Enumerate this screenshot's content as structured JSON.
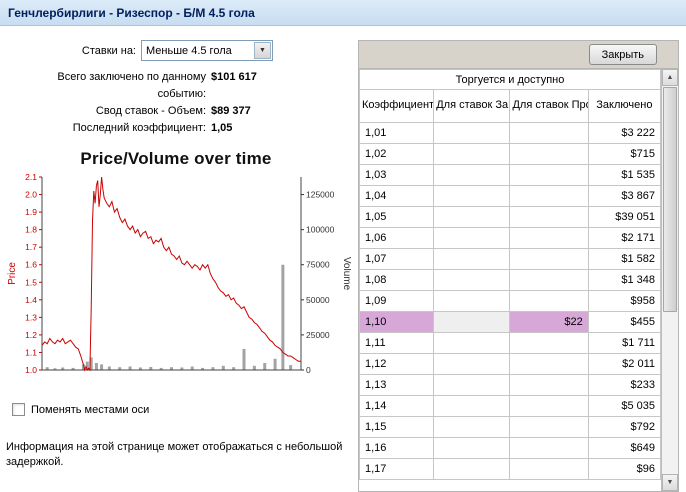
{
  "header": {
    "title": "Генчлербирлиги - Ризеспор - Б/М 4.5 гола"
  },
  "left_panel": {
    "bet_on_label": "Ставки на:",
    "bet_on_value": "Меньше 4.5 гола",
    "stats": [
      {
        "label": "Всего заключено по данному событию:",
        "value": "$101 617"
      },
      {
        "label": "Свод ставок - Объем:",
        "value": "$89 377"
      },
      {
        "label": "Последний коэффициент:",
        "value": "1,05"
      }
    ],
    "swap_axes_label": "Поменять местами оси",
    "disclaimer": "Информация на этой странице может отображаться с небольшой задержкой."
  },
  "table": {
    "close_button_label": "Закрыть",
    "group_header": "Торгуется и доступно",
    "columns": [
      "Коэффициент",
      "Для ставок За",
      "Для ставок Против",
      "Заключено"
    ],
    "highlight_color": "#d7a8d7",
    "rows": [
      {
        "coefficient": "1,01",
        "back": "",
        "lay": "",
        "matched": "$3 222",
        "highlighted": false
      },
      {
        "coefficient": "1,02",
        "back": "",
        "lay": "",
        "matched": "$715",
        "highlighted": false
      },
      {
        "coefficient": "1,03",
        "back": "",
        "lay": "",
        "matched": "$1 535",
        "highlighted": false
      },
      {
        "coefficient": "1,04",
        "back": "",
        "lay": "",
        "matched": "$3 867",
        "highlighted": false
      },
      {
        "coefficient": "1,05",
        "back": "",
        "lay": "",
        "matched": "$39 051",
        "highlighted": false
      },
      {
        "coefficient": "1,06",
        "back": "",
        "lay": "",
        "matched": "$2 171",
        "highlighted": false
      },
      {
        "coefficient": "1,07",
        "back": "",
        "lay": "",
        "matched": "$1 582",
        "highlighted": false
      },
      {
        "coefficient": "1,08",
        "back": "",
        "lay": "",
        "matched": "$1 348",
        "highlighted": false
      },
      {
        "coefficient": "1,09",
        "back": "",
        "lay": "",
        "matched": "$958",
        "highlighted": false
      },
      {
        "coefficient": "1,10",
        "back": "",
        "lay": "$22",
        "matched": "$455",
        "highlighted": true
      },
      {
        "coefficient": "1,11",
        "back": "",
        "lay": "",
        "matched": "$1 711",
        "highlighted": false
      },
      {
        "coefficient": "1,12",
        "back": "",
        "lay": "",
        "matched": "$2 011",
        "highlighted": false
      },
      {
        "coefficient": "1,13",
        "back": "",
        "lay": "",
        "matched": "$233",
        "highlighted": false
      },
      {
        "coefficient": "1,14",
        "back": "",
        "lay": "",
        "matched": "$5 035",
        "highlighted": false
      },
      {
        "coefficient": "1,15",
        "back": "",
        "lay": "",
        "matched": "$792",
        "highlighted": false
      },
      {
        "coefficient": "1,16",
        "back": "",
        "lay": "",
        "matched": "$649",
        "highlighted": false
      },
      {
        "coefficient": "1,17",
        "back": "",
        "lay": "",
        "matched": "$96",
        "highlighted": false
      }
    ]
  },
  "chart_data": {
    "type": "line",
    "title": "Price/Volume over time",
    "xlabel": "",
    "left_axis": {
      "label": "Price",
      "min": 1.0,
      "max": 2.1,
      "ticks": [
        1.0,
        1.1,
        1.2,
        1.3,
        1.4,
        1.5,
        1.6,
        1.7,
        1.8,
        1.9,
        2.0,
        2.1
      ],
      "color": "#cc0000"
    },
    "right_axis": {
      "label": "Volume",
      "min": 0,
      "plot_max": 137500,
      "ticks": [
        0,
        25000,
        50000,
        75000,
        100000,
        125000
      ],
      "color": "#333333"
    },
    "line_color": "#cc0000",
    "bar_color": "#a3a3a3",
    "price_series": [
      [
        0.0,
        1.14
      ],
      [
        0.01,
        1.16
      ],
      [
        0.02,
        1.15
      ],
      [
        0.03,
        1.18
      ],
      [
        0.04,
        1.16
      ],
      [
        0.05,
        1.15
      ],
      [
        0.06,
        1.17
      ],
      [
        0.07,
        1.16
      ],
      [
        0.08,
        1.18
      ],
      [
        0.09,
        1.15
      ],
      [
        0.1,
        1.16
      ],
      [
        0.11,
        1.17
      ],
      [
        0.12,
        1.15
      ],
      [
        0.13,
        1.13
      ],
      [
        0.14,
        1.12
      ],
      [
        0.15,
        1.08
      ],
      [
        0.16,
        1.03
      ],
      [
        0.165,
        1.0
      ],
      [
        0.17,
        1.02
      ],
      [
        0.175,
        1.0
      ],
      [
        0.18,
        1.01
      ],
      [
        0.185,
        1.0
      ],
      [
        0.19,
        1.35
      ],
      [
        0.195,
        1.85
      ],
      [
        0.2,
        2.02
      ],
      [
        0.205,
        1.95
      ],
      [
        0.21,
        2.05
      ],
      [
        0.215,
        2.08
      ],
      [
        0.22,
        1.93
      ],
      [
        0.225,
        2.0
      ],
      [
        0.23,
        2.1
      ],
      [
        0.235,
        2.03
      ],
      [
        0.24,
        1.98
      ],
      [
        0.25,
        1.95
      ],
      [
        0.26,
        1.93
      ],
      [
        0.27,
        1.96
      ],
      [
        0.28,
        1.9
      ],
      [
        0.29,
        1.92
      ],
      [
        0.3,
        1.87
      ],
      [
        0.31,
        1.84
      ],
      [
        0.32,
        1.86
      ],
      [
        0.33,
        1.82
      ],
      [
        0.34,
        1.8
      ],
      [
        0.35,
        1.82
      ],
      [
        0.36,
        1.78
      ],
      [
        0.37,
        1.8
      ],
      [
        0.38,
        1.76
      ],
      [
        0.39,
        1.78
      ],
      [
        0.4,
        1.79
      ],
      [
        0.41,
        1.75
      ],
      [
        0.42,
        1.76
      ],
      [
        0.43,
        1.72
      ],
      [
        0.44,
        1.74
      ],
      [
        0.45,
        1.73
      ],
      [
        0.46,
        1.75
      ],
      [
        0.47,
        1.7
      ],
      [
        0.48,
        1.68
      ],
      [
        0.49,
        1.7
      ],
      [
        0.5,
        1.66
      ],
      [
        0.51,
        1.65
      ],
      [
        0.52,
        1.63
      ],
      [
        0.53,
        1.65
      ],
      [
        0.54,
        1.61
      ],
      [
        0.55,
        1.6
      ],
      [
        0.56,
        1.62
      ],
      [
        0.57,
        1.6
      ],
      [
        0.58,
        1.58
      ],
      [
        0.59,
        1.6
      ],
      [
        0.6,
        1.59
      ],
      [
        0.61,
        1.57
      ],
      [
        0.62,
        1.6
      ],
      [
        0.63,
        1.58
      ],
      [
        0.64,
        1.6
      ],
      [
        0.65,
        1.55
      ],
      [
        0.66,
        1.52
      ],
      [
        0.67,
        1.5
      ],
      [
        0.68,
        1.47
      ],
      [
        0.69,
        1.45
      ],
      [
        0.7,
        1.44
      ],
      [
        0.71,
        1.42
      ],
      [
        0.72,
        1.43
      ],
      [
        0.73,
        1.4
      ],
      [
        0.74,
        1.41
      ],
      [
        0.75,
        1.38
      ],
      [
        0.76,
        1.37
      ],
      [
        0.77,
        1.35
      ],
      [
        0.78,
        1.36
      ],
      [
        0.79,
        1.33
      ],
      [
        0.8,
        1.3
      ],
      [
        0.81,
        1.29
      ],
      [
        0.82,
        1.27
      ],
      [
        0.83,
        1.26
      ],
      [
        0.84,
        1.24
      ],
      [
        0.85,
        1.22
      ],
      [
        0.86,
        1.21
      ],
      [
        0.87,
        1.19
      ],
      [
        0.88,
        1.17
      ],
      [
        0.89,
        1.16
      ],
      [
        0.9,
        1.14
      ],
      [
        0.91,
        1.13
      ],
      [
        0.92,
        1.12
      ],
      [
        0.93,
        1.1
      ],
      [
        0.94,
        1.09
      ],
      [
        0.95,
        1.08
      ],
      [
        0.96,
        1.08
      ],
      [
        0.97,
        1.07
      ],
      [
        0.98,
        1.06
      ],
      [
        0.99,
        1.05
      ],
      [
        1.0,
        1.05
      ]
    ],
    "volume_bars": [
      [
        0.02,
        2000
      ],
      [
        0.05,
        1200
      ],
      [
        0.08,
        1800
      ],
      [
        0.12,
        1500
      ],
      [
        0.16,
        4000
      ],
      [
        0.175,
        6000
      ],
      [
        0.19,
        9000
      ],
      [
        0.21,
        5000
      ],
      [
        0.23,
        4000
      ],
      [
        0.26,
        2500
      ],
      [
        0.3,
        2000
      ],
      [
        0.34,
        2500
      ],
      [
        0.38,
        1800
      ],
      [
        0.42,
        2200
      ],
      [
        0.46,
        1500
      ],
      [
        0.5,
        2000
      ],
      [
        0.54,
        1800
      ],
      [
        0.58,
        2500
      ],
      [
        0.62,
        1500
      ],
      [
        0.66,
        2000
      ],
      [
        0.7,
        3000
      ],
      [
        0.74,
        2000
      ],
      [
        0.78,
        15000
      ],
      [
        0.82,
        3000
      ],
      [
        0.86,
        5000
      ],
      [
        0.9,
        8000
      ],
      [
        0.93,
        75000
      ],
      [
        0.96,
        3500
      ]
    ]
  }
}
